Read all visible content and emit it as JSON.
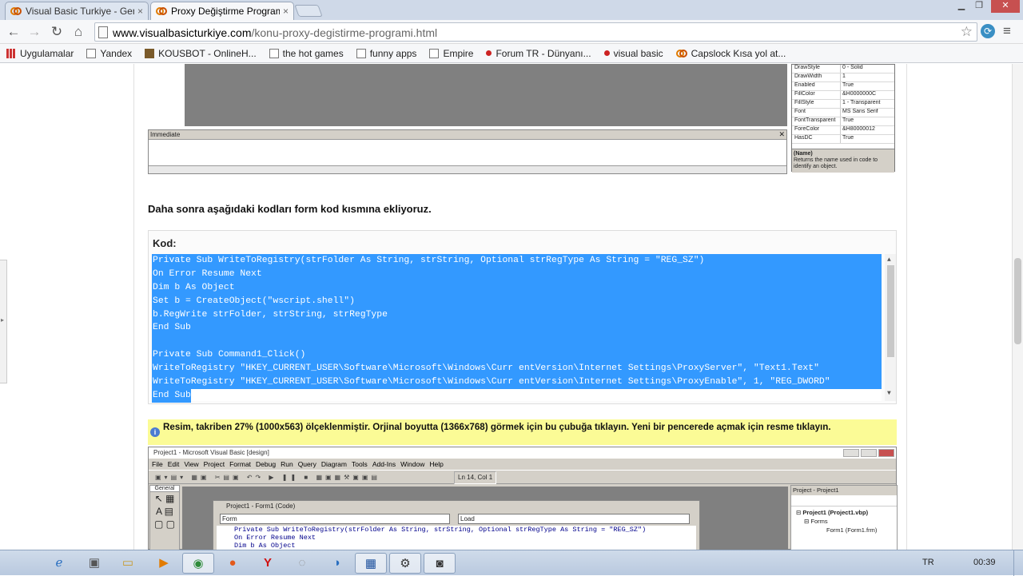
{
  "browser": {
    "tabs": [
      {
        "title": "Visual Basic Turkiye - Gen",
        "close": "×"
      },
      {
        "title": "Proxy Değiştirme Program",
        "close": "×"
      }
    ],
    "url_domain": "www.visualbasicturkiye.com",
    "url_path": "/konu-proxy-degistirme-programi.html",
    "bookmarks": [
      "Uygulamalar",
      "Yandex",
      "KOUSBOT - OnlineH...",
      "the hot games",
      "funny apps",
      "Empire",
      "Forum TR - Dünyanı...",
      "visual basic",
      "Capslock Kısa yol at..."
    ]
  },
  "screenshot_top": {
    "immediate_title": "Immediate",
    "props": [
      {
        "k": "DrawStyle",
        "v": "0 - Solid"
      },
      {
        "k": "DrawWidth",
        "v": "1"
      },
      {
        "k": "Enabled",
        "v": "True"
      },
      {
        "k": "FillColor",
        "v": "&H0000000C"
      },
      {
        "k": "FillStyle",
        "v": "1 - Transparent"
      },
      {
        "k": "Font",
        "v": "MS Sans Serif"
      },
      {
        "k": "FontTransparent",
        "v": "True"
      },
      {
        "k": "ForeColor",
        "v": "&H80000012"
      },
      {
        "k": "HasDC",
        "v": "True"
      }
    ],
    "desc_title": "(Name)",
    "desc_text": "Returns the name used in code to identify an object."
  },
  "article": {
    "heading": "Daha sonra aşağıdaki kodları form kod kısmına ekliyoruz.",
    "code_label": "Kod:",
    "code_lines": [
      "Private Sub WriteToRegistry(strFolder As String, strString, Optional strRegType As String = \"REG_SZ\")",
      "On Error Resume Next",
      "Dim b As Object",
      "Set b = CreateObject(\"wscript.shell\")",
      "b.RegWrite strFolder, strString, strRegType",
      "End Sub",
      "",
      "Private Sub Command1_Click()",
      "WriteToRegistry \"HKEY_CURRENT_USER\\Software\\Microsoft\\Windows\\Curr entVersion\\Internet Settings\\ProxyServer\", \"Text1.Text\"",
      "WriteToRegistry \"HKEY_CURRENT_USER\\Software\\Microsoft\\Windows\\Curr entVersion\\Internet Settings\\ProxyEnable\", 1, \"REG_DWORD\"",
      "End Sub"
    ],
    "notice": "Resim, takriben 27% (1000x563) ölçeklenmiştir. Orjinal boyutta (1366x768) görmek için bu çubuğa tıklayın. Yeni bir pencerede açmak için resme tıklayın."
  },
  "vb_screenshot": {
    "title": "Project1 - Microsoft Visual Basic [design]",
    "menu": [
      "File",
      "Edit",
      "View",
      "Project",
      "Format",
      "Debug",
      "Run",
      "Query",
      "Diagram",
      "Tools",
      "Add-Ins",
      "Window",
      "Help"
    ],
    "status": "Ln 14, Col 1",
    "general": "General",
    "code_window_title": "Project1 - Form1 (Code)",
    "dropdown_object": "Form",
    "dropdown_proc": "Load",
    "code_lines": [
      "Private Sub WriteToRegistry(strFolder As String, strString, Optional strRegType As String = \"REG_SZ\")",
      "On Error Resume Next",
      "Dim b As Object"
    ],
    "project_title": "Project - Project1",
    "project_tree": [
      "Project1 (Project1.vbp)",
      "Forms",
      "Form1 (Form1.frm)"
    ]
  },
  "taskbar": {
    "lang": "TR",
    "time": "00:39"
  }
}
